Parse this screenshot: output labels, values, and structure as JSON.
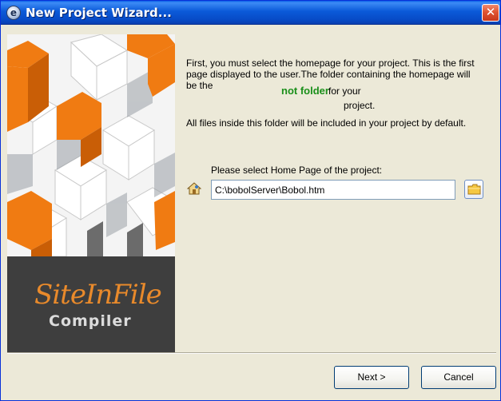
{
  "window": {
    "title": "New Project Wizard...",
    "app_icon_glyph": "e",
    "close_glyph": "✕",
    "icons": {
      "app": "app-logo-icon",
      "close": "close-icon"
    }
  },
  "sidebar": {
    "brand_script": "SiteInFile",
    "brand_sub": "Compiler",
    "accent_color": "#f07b12",
    "background_color": "#3e3e3e"
  },
  "content": {
    "intro_text": "First, you must select the homepage for your project. This is the first page displayed to the user.The folder containing the homepage will be the",
    "overlay_text": "not folder",
    "for_your_text": "for your",
    "project_text": "project.",
    "info_text": "All files inside this folder will be included in your project by default.",
    "select_label": "Please select Home Page of the project:",
    "home_page_path": "C:\\bobolServer\\Bobol.htm",
    "icons": {
      "home": "home-icon",
      "browse": "folder-icon"
    }
  },
  "buttons": {
    "next_label": "Next >",
    "cancel_label": "Cancel"
  }
}
